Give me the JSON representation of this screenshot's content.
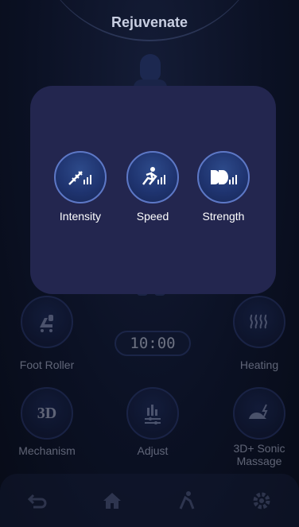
{
  "header": {
    "title": "Rejuvenate"
  },
  "timer": {
    "value": "10:00"
  },
  "controls": [
    {
      "id": "foot-roller",
      "label": "Foot Roller",
      "icon": "foot-roller-icon"
    },
    {
      "id": "heating",
      "label": "Heating",
      "icon": "heating-icon"
    },
    {
      "id": "mechanism",
      "label": "Mechanism",
      "icon": "3d-icon",
      "icon_text": "3D"
    },
    {
      "id": "adjust",
      "label": "Adjust",
      "icon": "adjust-icon"
    },
    {
      "id": "sonic",
      "label": "3D+ Sonic\nMassage",
      "icon": "sonic-massage-icon"
    }
  ],
  "overlay": {
    "options": [
      {
        "label": "Intensity",
        "icon": "intensity-icon"
      },
      {
        "label": "Speed",
        "icon": "speed-icon"
      },
      {
        "label": "Strength",
        "icon": "strength-icon"
      }
    ]
  },
  "nav": [
    {
      "icon": "back-icon"
    },
    {
      "icon": "home-icon"
    },
    {
      "icon": "massage-icon"
    },
    {
      "icon": "settings-icon"
    }
  ],
  "colors": {
    "accent": "#5d78c6",
    "overlay_bg": "#23264f",
    "background": "#0a0f1f"
  }
}
